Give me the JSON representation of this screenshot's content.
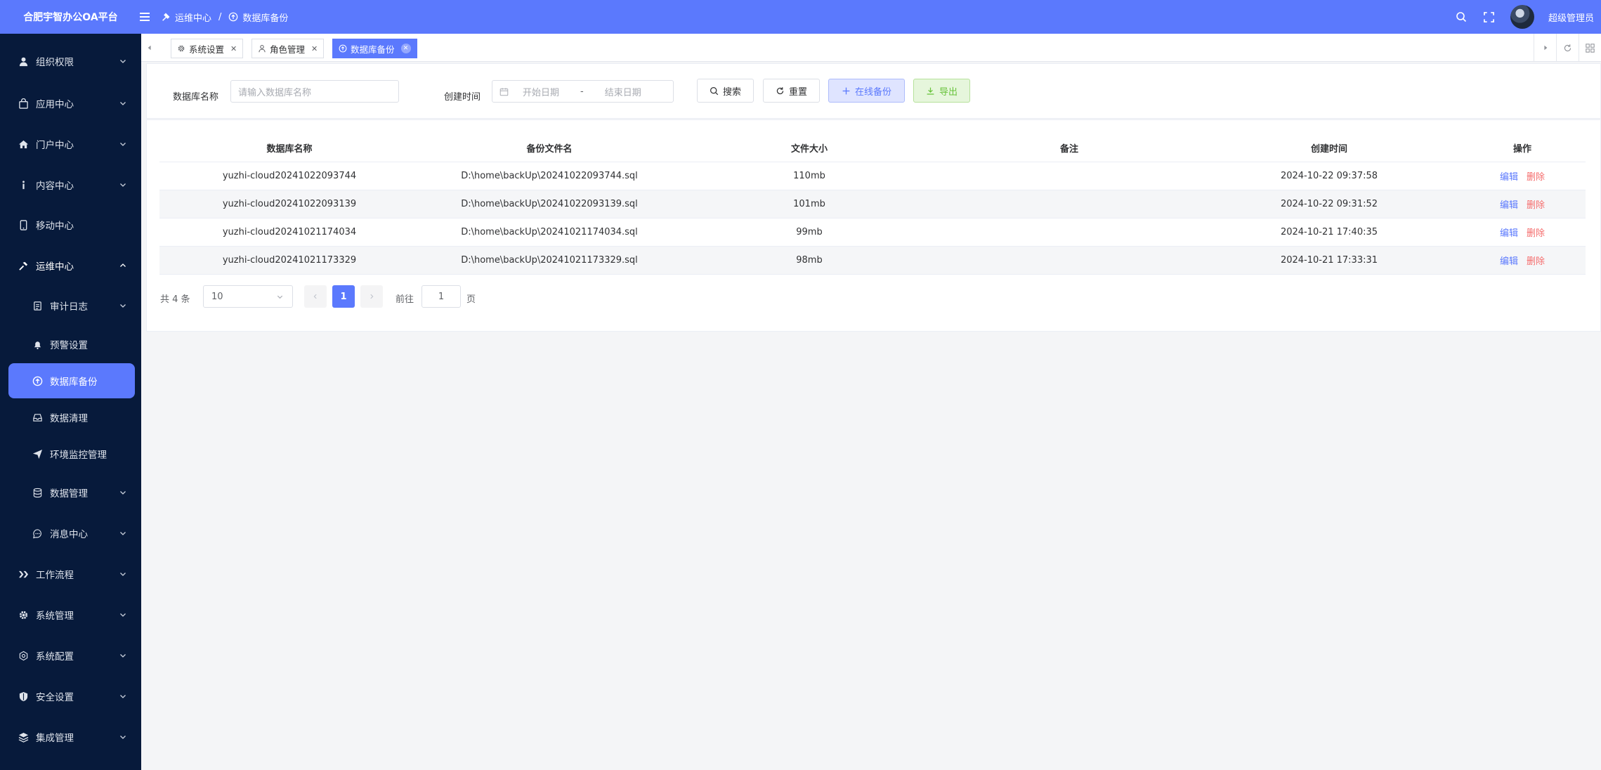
{
  "topbar": {
    "brand": "合肥宇智办公OA平台",
    "breadcrumb": [
      "运维中心",
      "数据库备份"
    ],
    "username": "超级管理员"
  },
  "sidebar": {
    "items": [
      {
        "label": "组织权限",
        "icon": "user-icon",
        "expandable": true
      },
      {
        "label": "应用中心",
        "icon": "bag-icon",
        "expandable": true
      },
      {
        "label": "门户中心",
        "icon": "home-icon",
        "expandable": true
      },
      {
        "label": "内容中心",
        "icon": "info-icon",
        "expandable": true
      },
      {
        "label": "移动中心",
        "icon": "mobile-icon",
        "expandable": false
      },
      {
        "label": "运维中心",
        "icon": "hammer-icon",
        "expandable": true,
        "expanded": true
      },
      {
        "label": "审计日志",
        "icon": "document-icon",
        "expandable": true,
        "sub": true
      },
      {
        "label": "预警设置",
        "icon": "bell-icon",
        "expandable": false,
        "sub": true
      },
      {
        "label": "数据库备份",
        "icon": "upload-circle-icon",
        "expandable": false,
        "sub": true,
        "active": true
      },
      {
        "label": "数据清理",
        "icon": "drawer-icon",
        "expandable": false,
        "sub": true
      },
      {
        "label": "环境监控管理",
        "icon": "send-icon",
        "expandable": false,
        "sub": true
      },
      {
        "label": "数据管理",
        "icon": "database-icon",
        "expandable": true,
        "sub": true
      },
      {
        "label": "消息中心",
        "icon": "chat-icon",
        "expandable": true,
        "sub": true
      },
      {
        "label": "工作流程",
        "icon": "flow-icon",
        "expandable": true
      },
      {
        "label": "系统管理",
        "icon": "gear-icon",
        "expandable": true
      },
      {
        "label": "系统配置",
        "icon": "settings-icon",
        "expandable": true
      },
      {
        "label": "安全设置",
        "icon": "shield-icon",
        "expandable": true
      },
      {
        "label": "集成管理",
        "icon": "layers-icon",
        "expandable": true
      }
    ]
  },
  "tabs": [
    {
      "label": "系统设置",
      "icon": "gear-icon"
    },
    {
      "label": "角色管理",
      "icon": "user-icon"
    },
    {
      "label": "数据库备份",
      "icon": "upload-circle-icon",
      "active": true
    }
  ],
  "filter": {
    "db_name_label": "数据库名称",
    "db_name_placeholder": "请输入数据库名称",
    "created_label": "创建时间",
    "start_placeholder": "开始日期",
    "range_sep": "-",
    "end_placeholder": "结束日期",
    "search_label": "搜索",
    "reset_label": "重置",
    "backup_label": "在线备份",
    "export_label": "导出"
  },
  "table": {
    "headers": [
      "数据库名称",
      "备份文件名",
      "文件大小",
      "备注",
      "创建时间",
      "操作"
    ],
    "rows": [
      {
        "name": "yuzhi-cloud20241022093744",
        "file": "D:\\home\\backUp\\20241022093744.sql",
        "size": "110mb",
        "note": "",
        "created": "2024-10-22 09:37:58"
      },
      {
        "name": "yuzhi-cloud20241022093139",
        "file": "D:\\home\\backUp\\20241022093139.sql",
        "size": "101mb",
        "note": "",
        "created": "2024-10-22 09:31:52"
      },
      {
        "name": "yuzhi-cloud20241021174034",
        "file": "D:\\home\\backUp\\20241021174034.sql",
        "size": "99mb",
        "note": "",
        "created": "2024-10-21 17:40:35"
      },
      {
        "name": "yuzhi-cloud20241021173329",
        "file": "D:\\home\\backUp\\20241021173329.sql",
        "size": "98mb",
        "note": "",
        "created": "2024-10-21 17:33:31"
      }
    ],
    "edit_label": "编辑",
    "delete_label": "删除"
  },
  "pagination": {
    "total_text": "共 4 条",
    "page_size": "10",
    "current_page": "1",
    "goto_prefix": "前往",
    "goto_value": "1",
    "goto_suffix": "页"
  },
  "colors": {
    "primary": "#5b79fd",
    "sidebar_bg": "#071a3b",
    "danger": "#f56c6c",
    "success": "#67c23a"
  }
}
